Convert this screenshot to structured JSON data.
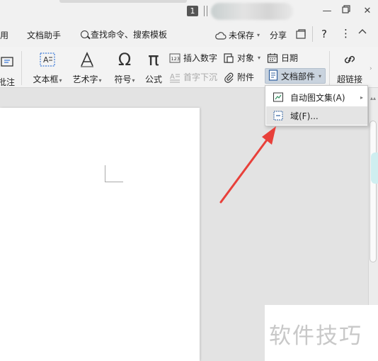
{
  "titlebar": {
    "page_badge": "1",
    "icons": [
      "minimize-icon",
      "restore-icon",
      "close-icon"
    ]
  },
  "menu": {
    "partial_tab": "用",
    "doc_assistant": "文档助手",
    "search_label": "查找命令、搜索模板",
    "save_status": "未保存",
    "share": "分享"
  },
  "ribbon": {
    "comment": "批注",
    "textbox": "文本框",
    "wordart": "艺术字",
    "symbol": "符号",
    "formula": "公式",
    "insert_number": "插入数字",
    "object": "对象",
    "date": "日期",
    "drop_cap": "首字下沉",
    "attachment": "附件",
    "doc_parts": "文档部件",
    "hyperlink": "超链接"
  },
  "dropdown": {
    "items": [
      {
        "label": "自动图文集(A)",
        "icon": "autotext-icon",
        "has_submenu": true
      },
      {
        "label": "域(F)...",
        "icon": "field-icon",
        "has_submenu": false
      }
    ]
  },
  "watermark": {
    "text": "软件技巧"
  },
  "colors": {
    "accent_arrow": "#e8403a",
    "hover_bg": "#e4e4e4",
    "selected_button_bg": "#c9d3de"
  }
}
